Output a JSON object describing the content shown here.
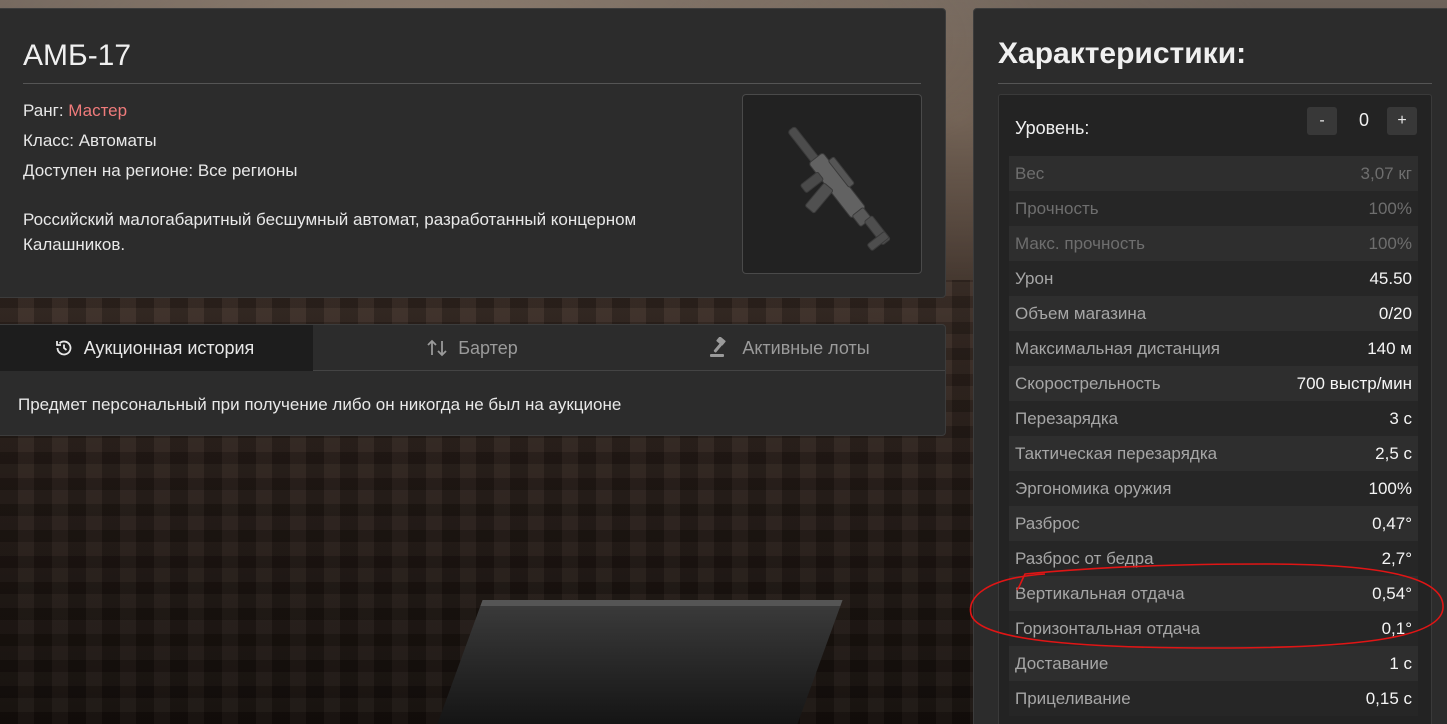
{
  "item": {
    "name": "АМБ-17",
    "rank_label": "Ранг:",
    "rank_value": "Мастер",
    "class_line": "Класс: Автоматы",
    "region_line": "Доступен на регионе: Все регионы",
    "description": "Российский малогабаритный бесшумный автомат, разработанный концерном Калашников.",
    "image_icon": "rifle-icon"
  },
  "tabs": [
    {
      "label": "Аукционная история",
      "icon": "history-icon",
      "active": true
    },
    {
      "label": "Бартер",
      "icon": "swap-icon",
      "active": false
    },
    {
      "label": "Активные лоты",
      "icon": "gavel-icon",
      "active": false
    }
  ],
  "tab_content": "Предмет персональный при получение либо он никогда не был на аукционе",
  "stats": {
    "title": "Характеристики:",
    "level_label": "Уровень:",
    "level_value": "0",
    "minus_label": "-",
    "plus_label": "+",
    "rows": [
      {
        "name": "Вес",
        "value": "3,07 кг",
        "muted": true
      },
      {
        "name": "Прочность",
        "value": "100%",
        "muted": true
      },
      {
        "name": "Макс. прочность",
        "value": "100%",
        "muted": true
      },
      {
        "name": "Урон",
        "value": "45.50",
        "muted": false
      },
      {
        "name": "Объем магазина",
        "value": "0/20",
        "muted": false
      },
      {
        "name": "Максимальная дистанция",
        "value": "140 м",
        "muted": false
      },
      {
        "name": "Скорострельность",
        "value": "700 выстр/мин",
        "muted": false
      },
      {
        "name": "Перезарядка",
        "value": "3 с",
        "muted": false
      },
      {
        "name": "Тактическая перезарядка",
        "value": "2,5 с",
        "muted": false
      },
      {
        "name": "Эргономика оружия",
        "value": "100%",
        "muted": false
      },
      {
        "name": "Разброс",
        "value": "0,47°",
        "muted": false
      },
      {
        "name": "Разброс от бедра",
        "value": "2,7°",
        "muted": false
      },
      {
        "name": "Вертикальная отдача",
        "value": "0,54°",
        "muted": false
      },
      {
        "name": "Горизонтальная отдача",
        "value": "0,1°",
        "muted": false
      },
      {
        "name": "Доставание",
        "value": "1 с",
        "muted": false
      },
      {
        "name": "Прицеливание",
        "value": "0,15 с",
        "muted": false
      }
    ]
  },
  "colors": {
    "rank": "#ef7b7b",
    "annotation": "#e01515"
  }
}
